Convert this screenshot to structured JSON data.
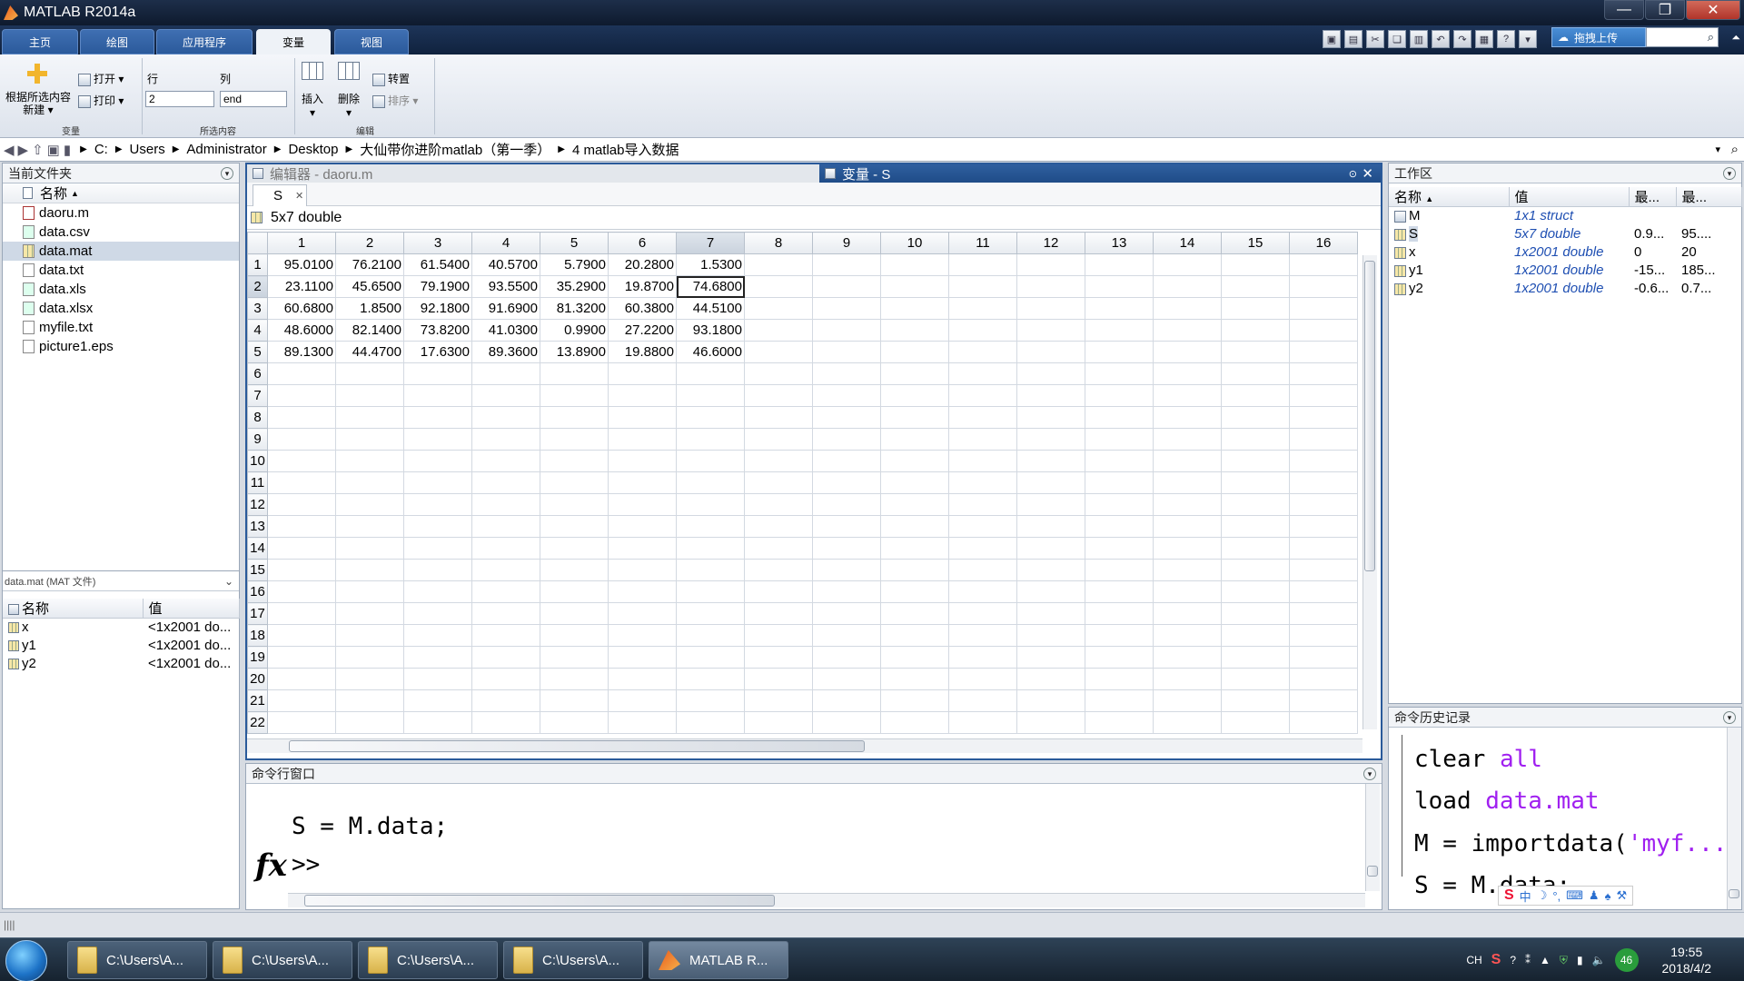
{
  "window": {
    "title": "MATLAB R2014a",
    "minimize": "—",
    "maximize": "❐",
    "close": "✕"
  },
  "tabs": [
    {
      "label": "主页"
    },
    {
      "label": "绘图"
    },
    {
      "label": "应用程序"
    },
    {
      "label": "变量"
    },
    {
      "label": "视图"
    }
  ],
  "cloud": {
    "label": "拖拽上传"
  },
  "ribbon": {
    "new_label_line1": "根据所选内容",
    "new_label_line2": "新建",
    "open": "打开",
    "print": "打印",
    "row_label": "行",
    "col_label": "列",
    "row_value": "2",
    "col_value": "end",
    "insert": "插入",
    "delete": "删除",
    "transpose": "转置",
    "sort": "排序",
    "group_variable": "变量",
    "group_selection": "所选内容",
    "group_edit": "编辑"
  },
  "address": {
    "crumbs": [
      "C:",
      "Users",
      "Administrator",
      "Desktop",
      "大仙带你进阶matlab（第一季）",
      "4 matlab导入数据"
    ]
  },
  "current_folder": {
    "title": "当前文件夹",
    "name_header": "名称",
    "files": [
      "daoru.m",
      "data.csv",
      "data.mat",
      "data.txt",
      "data.xls",
      "data.xlsx",
      "myfile.txt",
      "picture1.eps"
    ],
    "selected": "data.mat"
  },
  "details": {
    "title": "data.mat (MAT 文件)",
    "name_header": "名称",
    "value_header": "值",
    "rows": [
      {
        "name": "x",
        "value": "<1x2001 do..."
      },
      {
        "name": "y1",
        "value": "<1x2001 do..."
      },
      {
        "name": "y2",
        "value": "<1x2001 do..."
      }
    ]
  },
  "editor": {
    "editor_tab": "编辑器 - daoru.m",
    "variable_tab": "变量 - S",
    "doc_tab": "S",
    "var_info": "5x7 double",
    "col_headers": [
      "1",
      "2",
      "3",
      "4",
      "5",
      "6",
      "7",
      "8",
      "9",
      "10",
      "11",
      "12",
      "13",
      "14",
      "15",
      "16"
    ],
    "row_headers": [
      "1",
      "2",
      "3",
      "4",
      "5",
      "6",
      "7",
      "8",
      "9",
      "10",
      "11",
      "12",
      "13",
      "14",
      "15",
      "16",
      "17",
      "18",
      "19",
      "20",
      "21",
      "22"
    ],
    "cells": [
      [
        "95.0100",
        "76.2100",
        "61.5400",
        "40.5700",
        "5.7900",
        "20.2800",
        "1.5300"
      ],
      [
        "23.1100",
        "45.6500",
        "79.1900",
        "93.5500",
        "35.2900",
        "19.8700",
        "74.6800"
      ],
      [
        "60.6800",
        "1.8500",
        "92.1800",
        "91.6900",
        "81.3200",
        "60.3800",
        "44.5100"
      ],
      [
        "48.6000",
        "82.1400",
        "73.8200",
        "41.0300",
        "0.9900",
        "27.2200",
        "93.1800"
      ],
      [
        "89.1300",
        "44.4700",
        "17.6300",
        "89.3600",
        "13.8900",
        "19.8800",
        "46.6000"
      ]
    ]
  },
  "command_window": {
    "title": "命令行窗口",
    "line1": "S = M.data;",
    "prompt": ">>",
    "fx": "fx"
  },
  "workspace": {
    "title": "工作区",
    "headers": [
      "名称",
      "值",
      "最...",
      "最..."
    ],
    "rows": [
      {
        "name": "M",
        "value": "1x1 struct",
        "min": "",
        "max": ""
      },
      {
        "name": "S",
        "value": "5x7 double",
        "min": "0.9...",
        "max": "95...."
      },
      {
        "name": "x",
        "value": "1x2001 double",
        "min": "0",
        "max": "20"
      },
      {
        "name": "y1",
        "value": "1x2001 double",
        "min": "-15...",
        "max": "185..."
      },
      {
        "name": "y2",
        "value": "1x2001 double",
        "min": "-0.6...",
        "max": "0.7..."
      }
    ]
  },
  "history": {
    "title": "命令历史记录",
    "l1_a": "clear",
    "l1_b": "all",
    "l2_a": "load",
    "l2_b": "data.mat",
    "l3_a": "M = importdata(",
    "l3_b": "'myf...",
    "l4": "S = M.data;"
  },
  "status": {
    "text": "||||"
  },
  "taskbar": {
    "tasks": [
      {
        "label": "C:\\Users\\A..."
      },
      {
        "label": "C:\\Users\\A..."
      },
      {
        "label": "C:\\Users\\A..."
      },
      {
        "label": "C:\\Users\\A..."
      },
      {
        "label": "MATLAB R..."
      }
    ],
    "tray_lang": "CH",
    "tray_badge": "46",
    "time": "19:55",
    "date": "2018/4/2"
  },
  "colors": {
    "accent": "#2b5a9b",
    "var_value": "#1f4fb2",
    "keyword": "#a020f0"
  }
}
